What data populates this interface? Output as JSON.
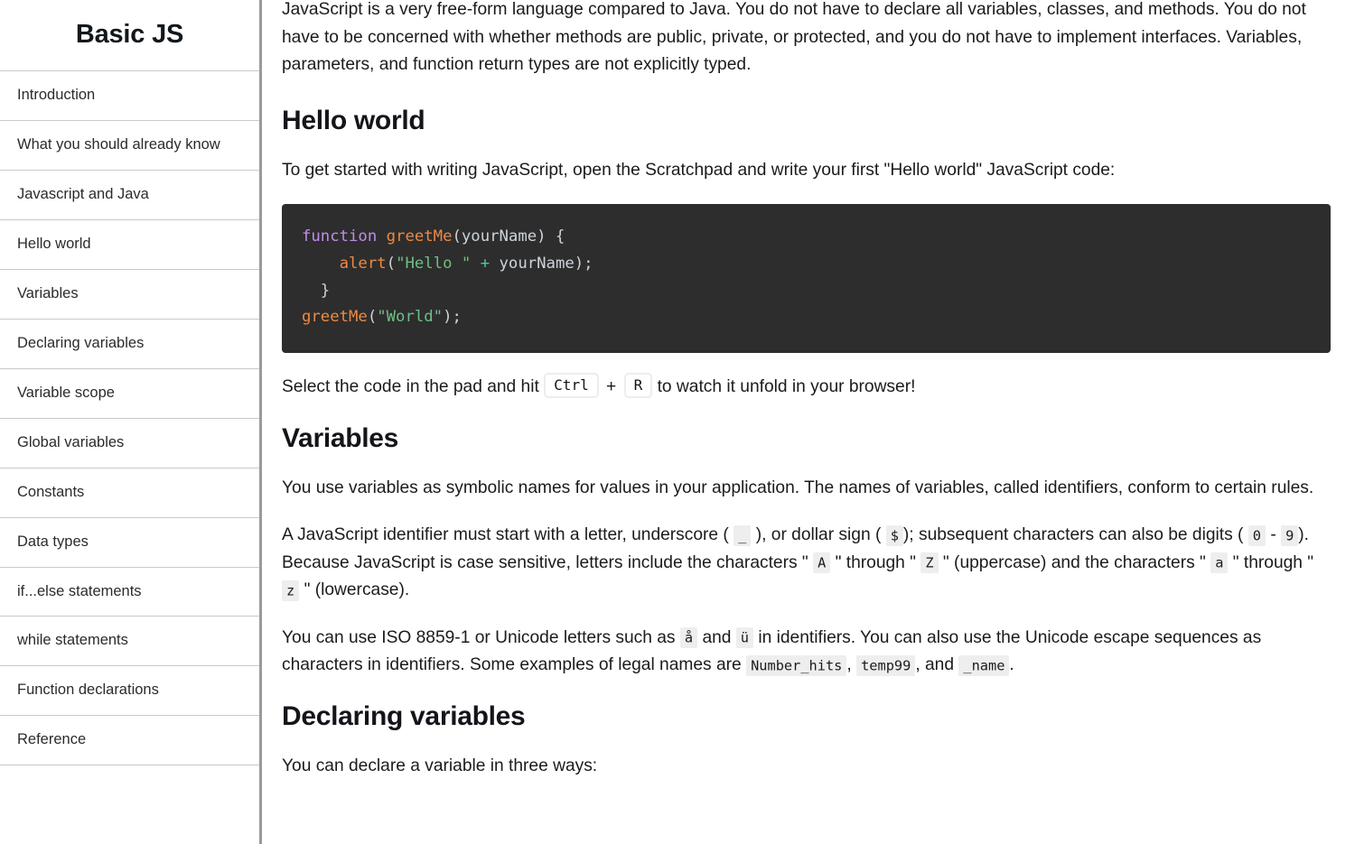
{
  "sidebar": {
    "title": "Basic JS",
    "items": [
      {
        "label": "Introduction"
      },
      {
        "label": "What you should already know"
      },
      {
        "label": "Javascript and Java"
      },
      {
        "label": "Hello world"
      },
      {
        "label": "Variables"
      },
      {
        "label": "Declaring variables"
      },
      {
        "label": "Variable scope"
      },
      {
        "label": "Global variables"
      },
      {
        "label": "Constants"
      },
      {
        "label": "Data types"
      },
      {
        "label": "if...else statements"
      },
      {
        "label": "while statements"
      },
      {
        "label": "Function declarations"
      },
      {
        "label": "Reference"
      }
    ]
  },
  "main": {
    "intro_paragraph": "JavaScript is a very free-form language compared to Java. You do not have to declare all variables, classes, and methods. You do not have to be concerned with whether methods are public, private, or protected, and you do not have to implement interfaces. Variables, parameters, and function return types are not explicitly typed.",
    "hello_world": {
      "heading": "Hello world",
      "paragraph": "To get started with writing JavaScript, open the Scratchpad and write your first \"Hello world\" JavaScript code:",
      "code": {
        "language": "javascript",
        "raw": "function greetMe(yourName) {\n    alert(\"Hello \" + yourName);\n  }\ngreetMe(\"World\");",
        "tokens": [
          {
            "text": "function",
            "type": "keyword"
          },
          {
            "text": " ",
            "type": "plain"
          },
          {
            "text": "greetMe",
            "type": "function"
          },
          {
            "text": "(yourName) {",
            "type": "plain"
          },
          {
            "text": "\n    ",
            "type": "plain"
          },
          {
            "text": "alert",
            "type": "function"
          },
          {
            "text": "(",
            "type": "plain"
          },
          {
            "text": "\"Hello \"",
            "type": "string"
          },
          {
            "text": " ",
            "type": "plain"
          },
          {
            "text": "+",
            "type": "operator"
          },
          {
            "text": " yourName);",
            "type": "plain"
          },
          {
            "text": "\n  }\n",
            "type": "plain"
          },
          {
            "text": "greetMe",
            "type": "function"
          },
          {
            "text": "(",
            "type": "plain"
          },
          {
            "text": "\"World\"",
            "type": "string"
          },
          {
            "text": ");",
            "type": "plain"
          }
        ]
      },
      "run_hint": {
        "before": "Select the code in the pad and hit",
        "key1": "Ctrl",
        "separator": "+",
        "key2": "R",
        "after": "to watch it unfold in your browser!"
      }
    },
    "variables": {
      "heading": "Variables",
      "paragraph_1": "You use variables as symbolic names for values in your application. The names of variables, called identifiers, conform to certain rules.",
      "paragraph_2": {
        "seg_1": "A JavaScript identifier must start with a letter, underscore (",
        "code_underscore": "_",
        "seg_2": "), or dollar sign (",
        "code_dollar": "$",
        "seg_3": "); subsequent characters can also be digits (",
        "code_zero": "0",
        "seg_dash": "-",
        "code_nine": "9",
        "seg_4": "). Because JavaScript is case sensitive, letters include the characters \"",
        "code_A": "A",
        "seg_5": "\" through \"",
        "code_Z": "Z",
        "seg_6": "\" (uppercase) and the characters \"",
        "code_a": "a",
        "seg_7": "\" through \"",
        "code_z": "z",
        "seg_8": "\" (lowercase)."
      },
      "paragraph_3": {
        "seg_1": "You can use ISO 8859-1 or Unicode letters such as",
        "code_aring": "å",
        "seg_2": "and",
        "code_uuml": "ü",
        "seg_3": "in identifiers. You can also use the Unicode escape sequences as characters in identifiers. Some examples of legal names are",
        "code_number_hits": "Number_hits",
        "seg_comma_1": ",",
        "code_temp99": "temp99",
        "seg_4": ", and",
        "code_name": "_name",
        "seg_5": "."
      }
    },
    "declaring_variables": {
      "heading": "Declaring variables",
      "paragraph": "You can declare a variable in three ways:"
    }
  },
  "colors": {
    "page_background": "#ffffff",
    "text": "#1b1b1b",
    "heading": "#15141a",
    "sidebar_divider": "#c9c9c9",
    "sidebar_border": "#9a9a9a",
    "code_background": "#2d2d2d",
    "code_default": "#cdd3da",
    "code_keyword": "#c08ce8",
    "code_function": "#ec8a45",
    "code_string": "#6fbf86",
    "code_operator": "#4ec9a0",
    "chip_background": "#eeeeee",
    "kbd_border": "#ededed"
  }
}
